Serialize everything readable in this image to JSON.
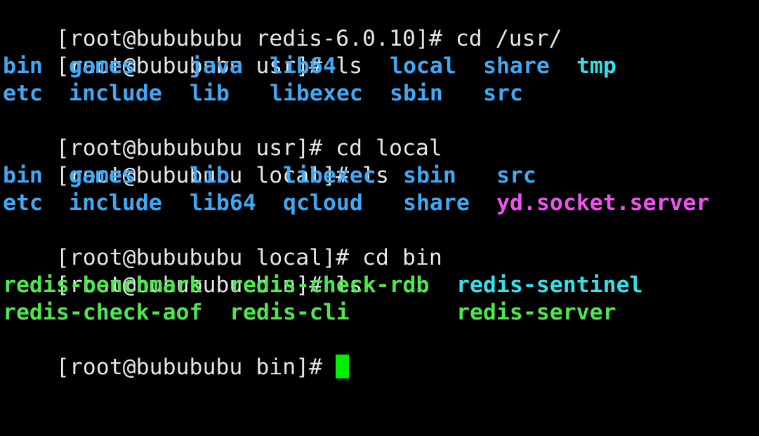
{
  "terminal": {
    "lines": [
      {
        "prompt": "[root@bubububu redis-6.0.10]# ",
        "command": "cd /usr/"
      },
      {
        "prompt": "[root@bubububu usr]# ",
        "command": "ls"
      },
      {
        "prompt": "[root@bubububu usr]# ",
        "command": "cd local"
      },
      {
        "prompt": "[root@bubububu local]# ",
        "command": "ls"
      },
      {
        "prompt": "[root@bubububu local]# ",
        "command": "cd bin"
      },
      {
        "prompt": "[root@bubububu bin]# ",
        "command": "ls"
      },
      {
        "prompt": "[root@bubububu bin]# ",
        "command": ""
      }
    ],
    "usr_listing": {
      "row1": [
        "bin",
        "games",
        "java",
        "lib64",
        "local",
        "share",
        "tmp"
      ],
      "row2": [
        "etc",
        "include",
        "lib",
        "libexec",
        "sbin",
        "src"
      ]
    },
    "local_listing": {
      "row1": [
        "bin",
        "games",
        "lib",
        "libexec",
        "sbin",
        "src"
      ],
      "row2": [
        "etc",
        "include",
        "lib64",
        "qcloud",
        "share",
        "yd.socket.server"
      ]
    },
    "bin_listing": {
      "row1": [
        "redis-benchmark",
        "redis-check-rdb",
        "redis-sentinel"
      ],
      "row2": [
        "redis-check-aof",
        "redis-cli",
        "redis-server"
      ]
    },
    "colors": {
      "text": "#e6e6e6",
      "directory": "#3fa9f5",
      "executable": "#4de84d",
      "symlink": "#35e0e8",
      "socket": "#f052f0",
      "cursor": "#00ee00",
      "background": "#000000"
    }
  }
}
